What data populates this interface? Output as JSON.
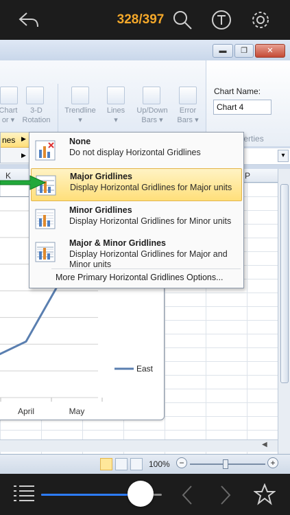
{
  "topbar": {
    "page_counter": "328/397"
  },
  "excel": {
    "ribbon": {
      "items": [
        {
          "line1": "Chart",
          "line2": "or ▾"
        },
        {
          "line1": "3-D",
          "line2": "Rotation"
        },
        {
          "line1": "Trendline",
          "line2": "▾"
        },
        {
          "line1": "Lines",
          "line2": "▾"
        },
        {
          "line1": "Up/Down",
          "line2": "Bars ▾"
        },
        {
          "line1": "Error",
          "line2": "Bars ▾"
        }
      ],
      "chart_name_label": "Chart Name:",
      "chart_name_value": "Chart 4",
      "properties_group_label": "Properties"
    },
    "side_menu": {
      "item1": "nes",
      "item2": ""
    },
    "column_headers": [
      "K",
      "P"
    ],
    "menu": {
      "items": [
        {
          "title": "None",
          "description": "Do not display Horizontal Gridlines"
        },
        {
          "title": "Major Gridlines",
          "description": "Display Horizontal Gridlines for Major units"
        },
        {
          "title": "Minor Gridlines",
          "description": "Display Horizontal Gridlines for Minor units"
        },
        {
          "title": "Major & Minor Gridlines",
          "description": "Display Horizontal Gridlines for Major and Minor units"
        }
      ],
      "more_options": "More Primary Horizontal Gridlines Options..."
    },
    "status": {
      "zoom": "100%"
    }
  },
  "chart_data": {
    "type": "line",
    "categories": [
      "April",
      "May"
    ],
    "series": [
      {
        "name": "East",
        "values": [
          30,
          78
        ]
      }
    ],
    "ylim": [
      0,
      100
    ],
    "legend": "right",
    "grid": true
  },
  "colors": {
    "accent": "#f4a82a",
    "slider_fill": "#2d7cff",
    "series_east": "#5a7fb0",
    "arrow": "#22a83a",
    "highlight": "#ffdf7a"
  }
}
